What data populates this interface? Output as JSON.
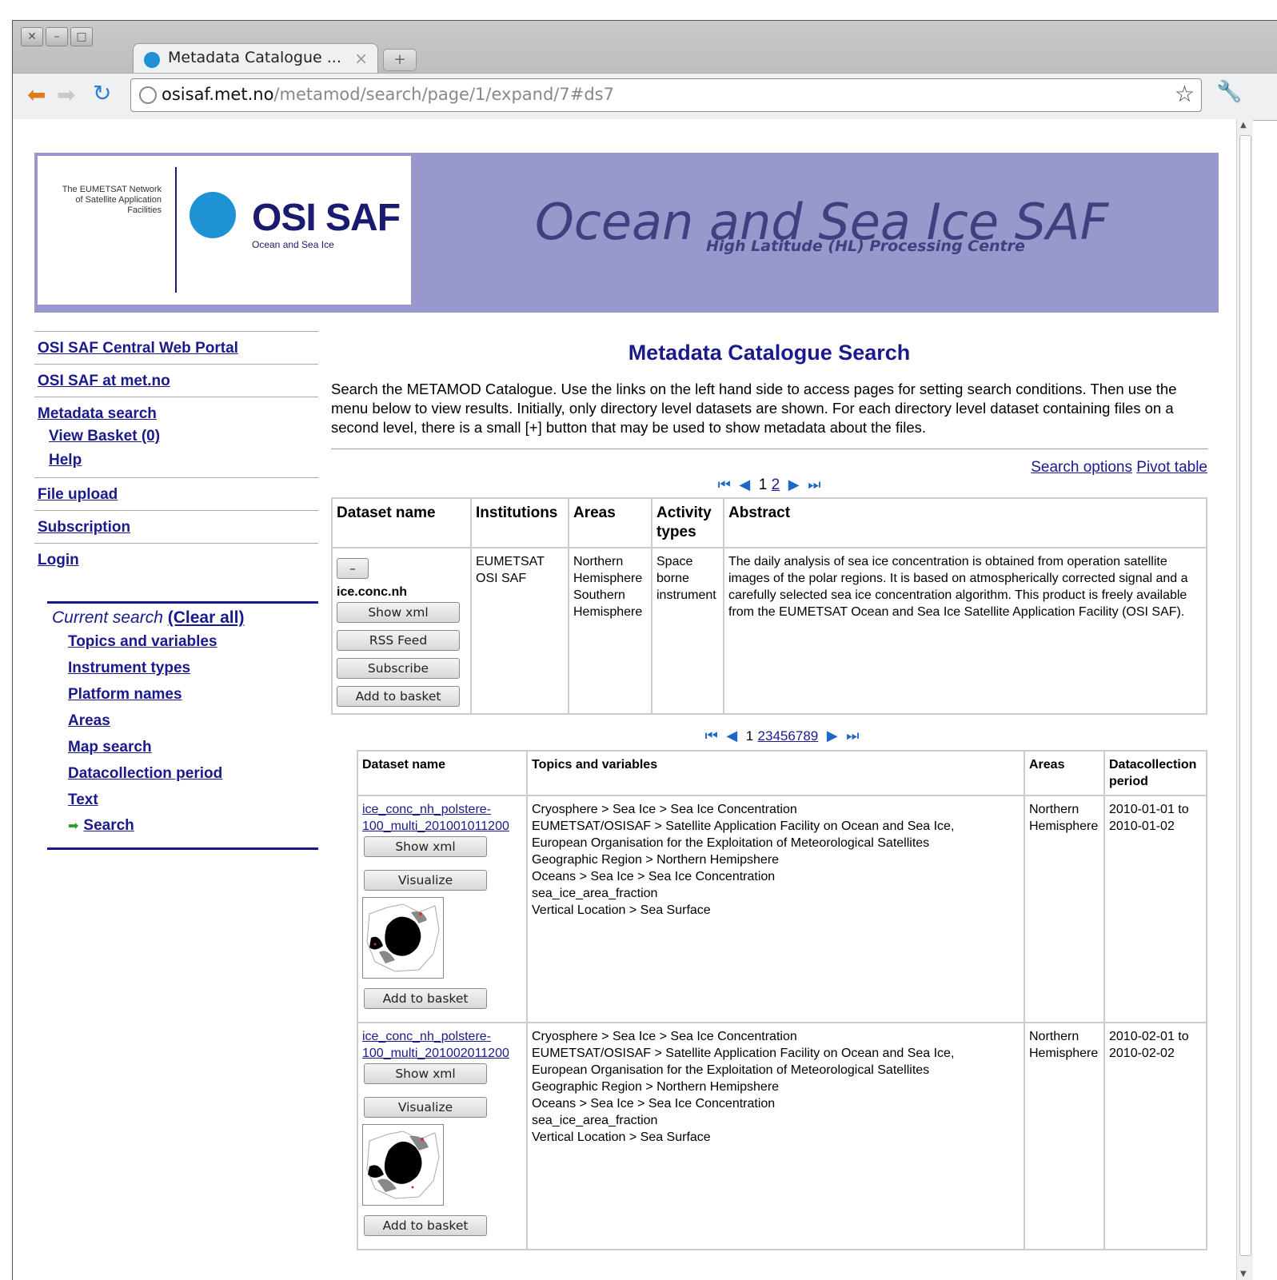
{
  "browser": {
    "tab_title": "Metadata Catalogue ...",
    "tab_close": "×",
    "new_tab": "+",
    "url_host": "osisaf.met.no",
    "url_path": "/metamod/search/page/1/expand/7#ds7"
  },
  "banner": {
    "eumetsat_text": "The EUMETSAT Network of Satellite Application Facilities",
    "logo_word": "OSI SAF",
    "logo_sub": "Ocean and Sea Ice",
    "title": "Ocean and Sea Ice SAF",
    "subtitle": "High Latitude (HL) Processing Centre"
  },
  "sidebar": {
    "items": [
      {
        "label": "OSI SAF Central Web Portal"
      },
      {
        "label": "OSI SAF at met.no"
      },
      {
        "label": "Metadata search"
      },
      {
        "label": "View Basket (0)"
      },
      {
        "label": "Help"
      },
      {
        "label": "File upload"
      },
      {
        "label": "Subscription"
      },
      {
        "label": "Login"
      }
    ],
    "current_search": {
      "heading": "Current search",
      "clear": "(Clear all)",
      "links": [
        "Topics and variables",
        "Instrument types",
        "Platform names",
        "Areas",
        "Map search",
        "Datacollection period",
        "Text"
      ],
      "search": "Search"
    }
  },
  "main": {
    "title": "Metadata Catalogue Search",
    "intro": "Search the METAMOD Catalogue. Use the links on the left hand side to access pages for setting search conditions. Then use the menu below to view results. Initially, only directory level datasets are shown. For each directory level dataset containing files on a second level, there is a small [+] button that may be used to show metadata about the files.",
    "search_options": "Search options",
    "pivot_table": "Pivot table",
    "pager1": {
      "current": "1",
      "other": "2"
    },
    "table1": {
      "headers": [
        "Dataset name",
        "Institutions",
        "Areas",
        "Activity types",
        "Abstract"
      ],
      "row": {
        "collapse": "–",
        "name": "ice.conc.nh",
        "buttons": [
          "Show xml",
          "RSS Feed",
          "Subscribe",
          "Add to basket"
        ],
        "institutions": "EUMETSAT OSI SAF",
        "areas": "Northern Hemisphere Southern Hemisphere",
        "activity": "Space borne instrument",
        "abstract": "The daily analysis of sea ice concentration is obtained from operation satellite images of the polar regions. It is based on atmospherically corrected signal and a carefully selected sea ice concentration algorithm. This product is freely available from the EUMETSAT Ocean and Sea Ice Satellite Application Facility (OSI SAF)."
      }
    },
    "pager2": {
      "current": "1",
      "pages": [
        "2",
        "3",
        "4",
        "5",
        "6",
        "7",
        "8",
        "9"
      ]
    },
    "table2": {
      "headers": [
        "Dataset name",
        "Topics and variables",
        "Areas",
        "Datacollection period"
      ],
      "rows": [
        {
          "name_line1": "ice_conc_nh_polstere-",
          "name_line2": "100_multi_201001011200",
          "show_xml": "Show xml",
          "visualize": "Visualize",
          "add_basket": "Add to basket",
          "topics": [
            "Cryosphere > Sea Ice > Sea Ice Concentration",
            "EUMETSAT/OSISAF > Satellite Application Facility on Ocean and Sea Ice,",
            "European Organisation for the Exploitation of Meteorological Satellites",
            "Geographic Region > Northern Hemipshere",
            "Oceans > Sea Ice > Sea Ice Concentration",
            "sea_ice_area_fraction",
            "Vertical Location > Sea Surface"
          ],
          "areas": "Northern Hemisphere",
          "period": "2010-01-01 to 2010-01-02"
        },
        {
          "name_line1": "ice_conc_nh_polstere-",
          "name_line2": "100_multi_201002011200",
          "show_xml": "Show xml",
          "visualize": "Visualize",
          "add_basket": "Add to basket",
          "topics": [
            "Cryosphere > Sea Ice > Sea Ice Concentration",
            "EUMETSAT/OSISAF > Satellite Application Facility on Ocean and Sea Ice,",
            "European Organisation for the Exploitation of Meteorological Satellites",
            "Geographic Region > Northern Hemipshere",
            "Oceans > Sea Ice > Sea Ice Concentration",
            "sea_ice_area_fraction",
            "Vertical Location > Sea Surface"
          ],
          "areas": "Northern Hemisphere",
          "period": "2010-02-01 to 2010-02-02"
        }
      ]
    }
  }
}
